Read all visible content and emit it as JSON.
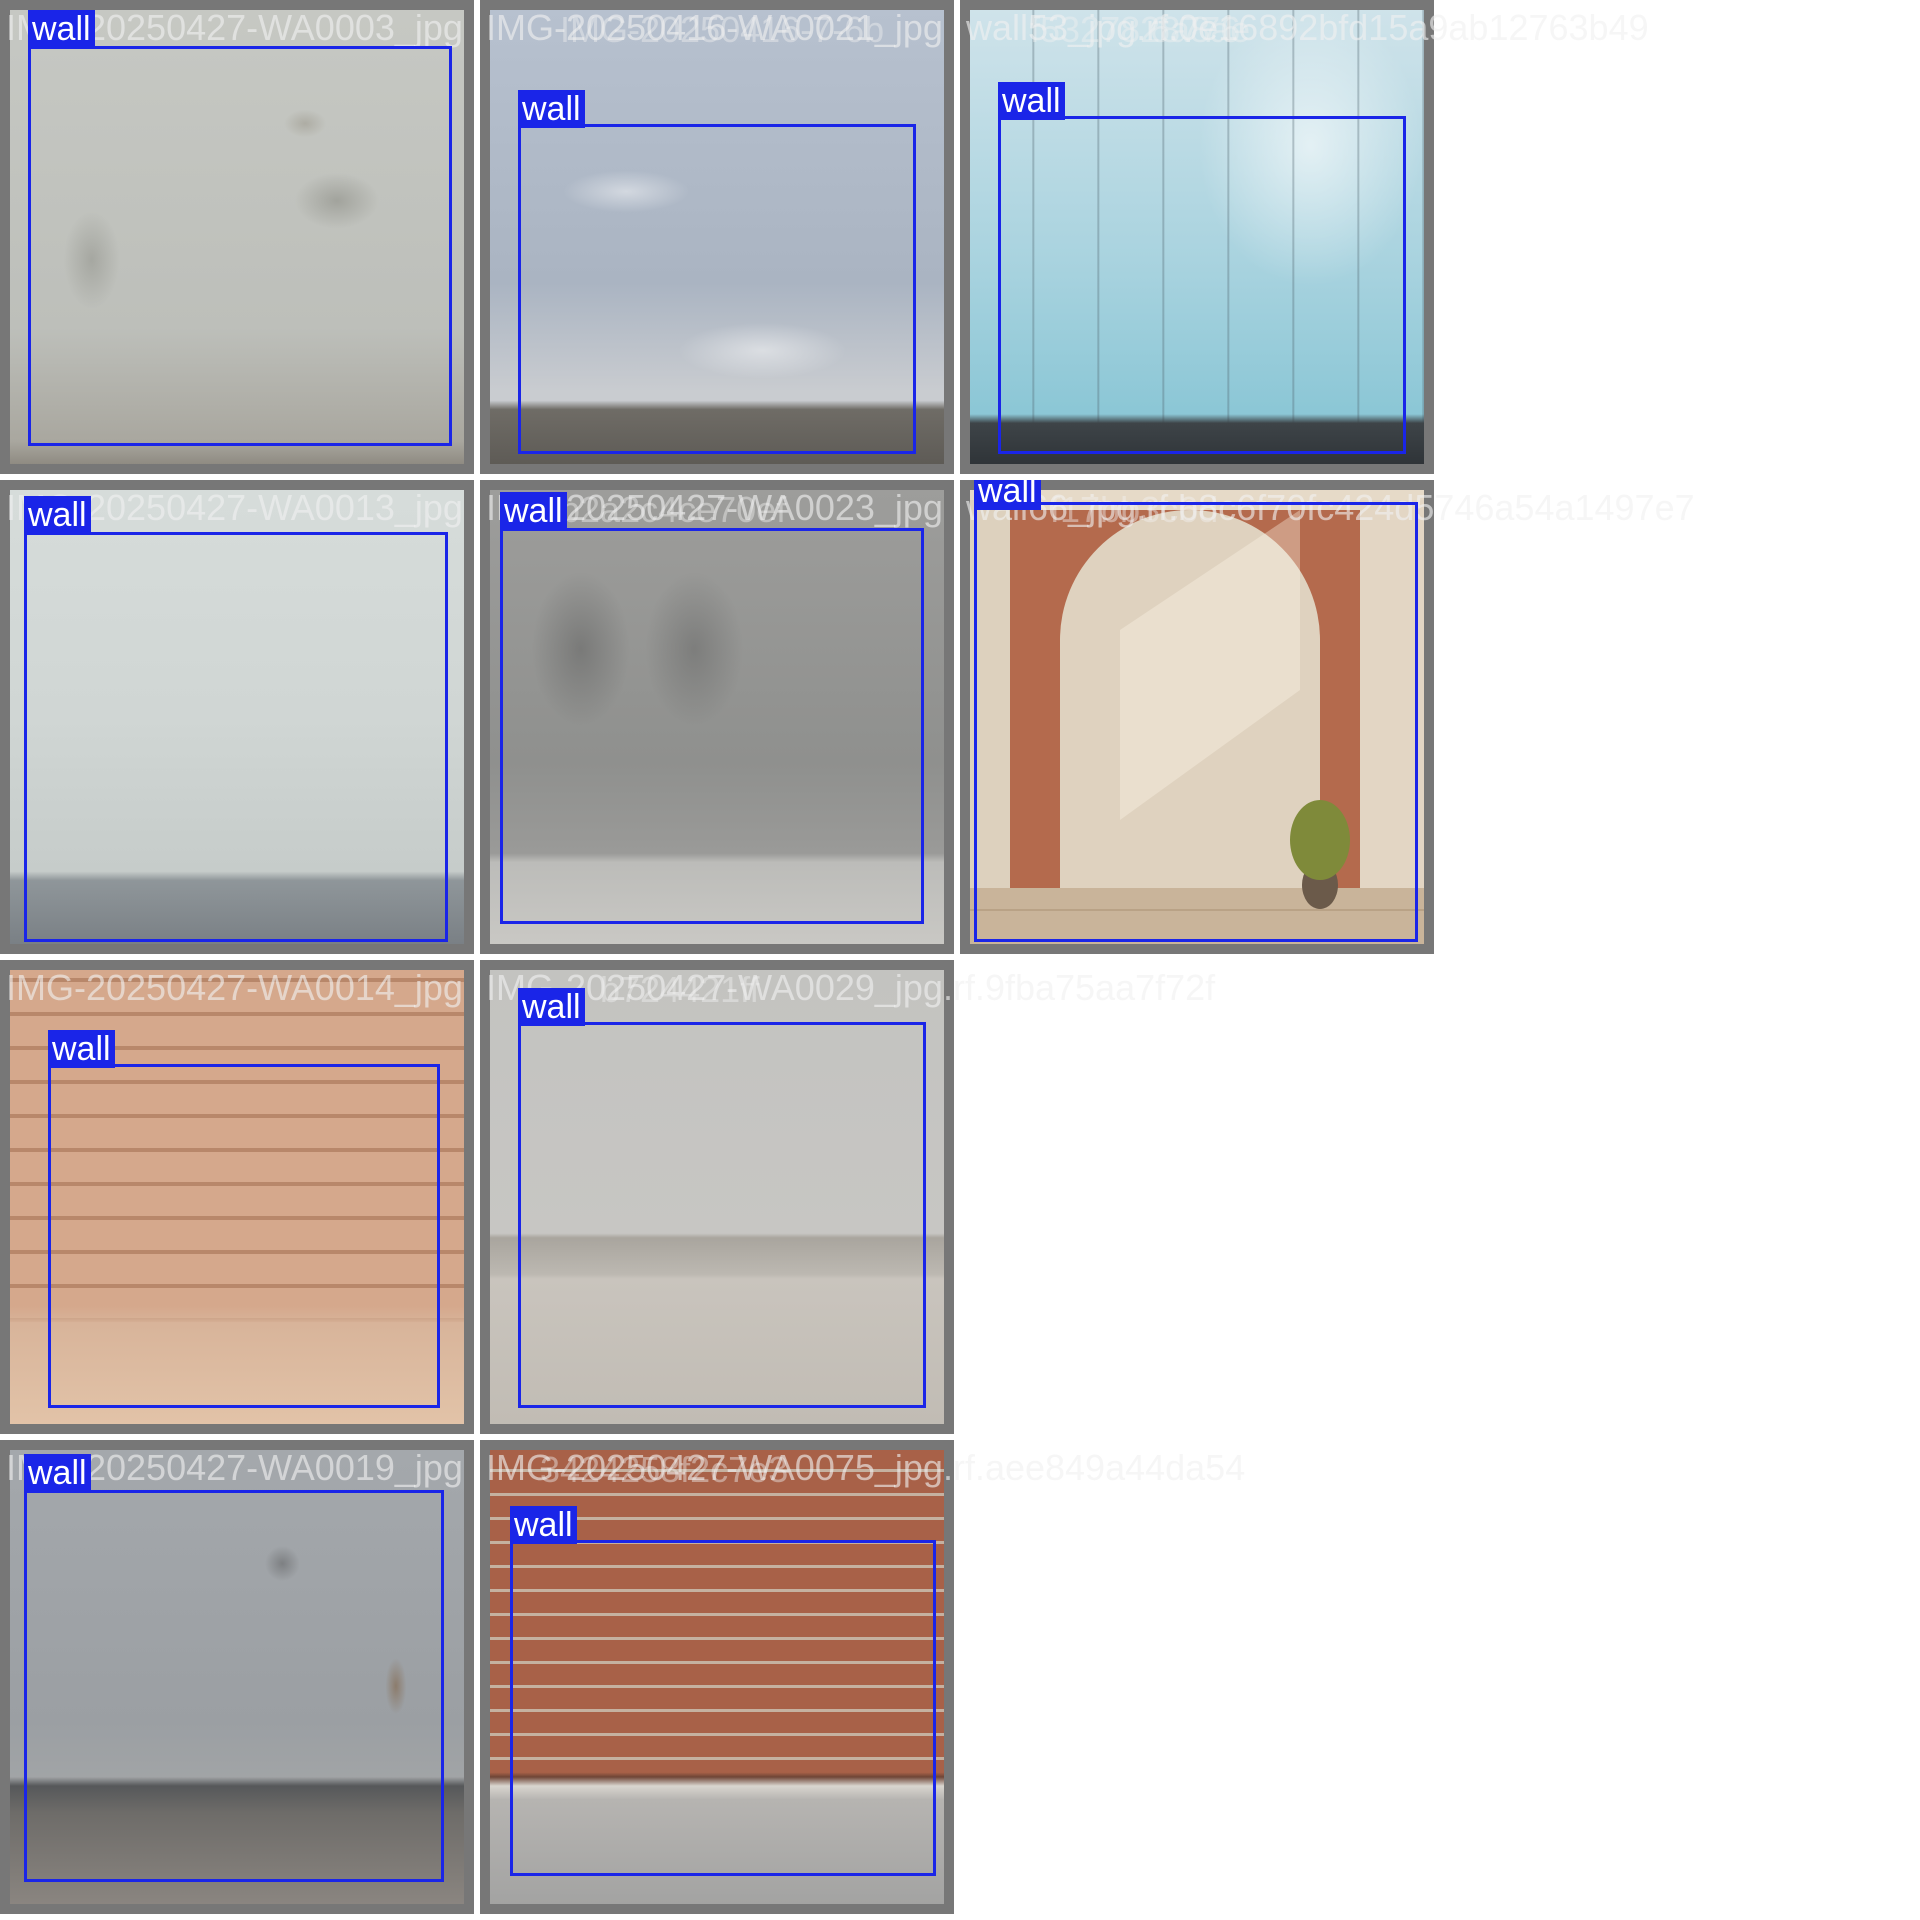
{
  "colors": {
    "background": "#ffffff",
    "tile_border": "#777777",
    "bbox": "#1a25e8",
    "label_text": "#ffffff",
    "filename_text": "#f0f0f0"
  },
  "tiles": [
    {
      "filename": "IMG-20250427-WA0003_jpg",
      "label": "wall",
      "photo": "plaster-wall"
    },
    {
      "filename": "IMG-20250416-WA0021_jpg",
      "label": "wall",
      "photo": "peeling-wall"
    },
    {
      "filename": "wall53_jpg.rf.0e16892bfd15a9ab12763b49",
      "label": "wall",
      "photo": "glass-panel-wall"
    },
    {
      "filename": "IMG-20250427-WA0013_jpg",
      "label": "wall",
      "photo": "white-wall"
    },
    {
      "filename": "IMG-20250427-WA0023_jpg",
      "label": "wall",
      "photo": "concrete-wall"
    },
    {
      "filename": "wall66_jpg.rf.b8c6f70fc424d5746a54a1497e7",
      "label": "wall",
      "photo": "brick-arch-wall"
    },
    {
      "filename": "IMG-20250427-WA0014_jpg",
      "label": "wall",
      "photo": "tan-brick-wall"
    },
    {
      "filename": "IMG-20250427-WA0029_jpg.rf.9fba75aa7f72f",
      "label": "wall",
      "photo": "room-wall"
    },
    {
      "filename": "IMG-20250427-WA0019_jpg",
      "label": "wall",
      "photo": "grey-wall"
    },
    {
      "filename": "IMG-20250427-WA0075_jpg.rf.aee849a44da54",
      "label": "wall",
      "photo": "red-brick-wall"
    }
  ],
  "overlapping_filename_fragments": [
    "IMG-20250416-7-6b",
    "f5327828776",
    "6a8ae",
    "f17bb3c6d",
    "b2a2c4ce70ef",
    "b724421ff",
    "3424258f2c7e3"
  ]
}
